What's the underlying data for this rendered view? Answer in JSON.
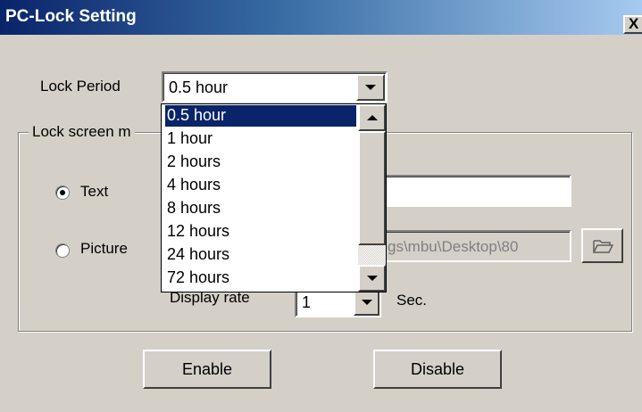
{
  "window": {
    "title": "PC-Lock Setting",
    "close_label": "X"
  },
  "lock_period": {
    "label": "Lock Period",
    "selected": "0.5 hour",
    "options": [
      "0.5 hour",
      "1  hour",
      "2  hours",
      "4  hours",
      "8  hours",
      "12  hours",
      "24  hours",
      "72  hours"
    ]
  },
  "lock_screen": {
    "group_label": "Lock screen m",
    "text_option": {
      "label": "Text",
      "checked": true,
      "value": ""
    },
    "picture_option": {
      "label": "Picture",
      "checked": false,
      "path": "gs\\mbu\\Desktop\\80"
    },
    "display_rate": {
      "label": "Display rate",
      "value": "1",
      "unit": "Sec."
    }
  },
  "buttons": {
    "enable": "Enable",
    "disable": "Disable"
  },
  "colors": {
    "title_start": "#0a246a",
    "title_end": "#a6caf0",
    "face": "#d4d0c8",
    "selection": "#0a246a"
  },
  "icons": {
    "folder": "folder-open-icon",
    "dropdown": "chevron-down-icon",
    "close": "close-icon"
  }
}
